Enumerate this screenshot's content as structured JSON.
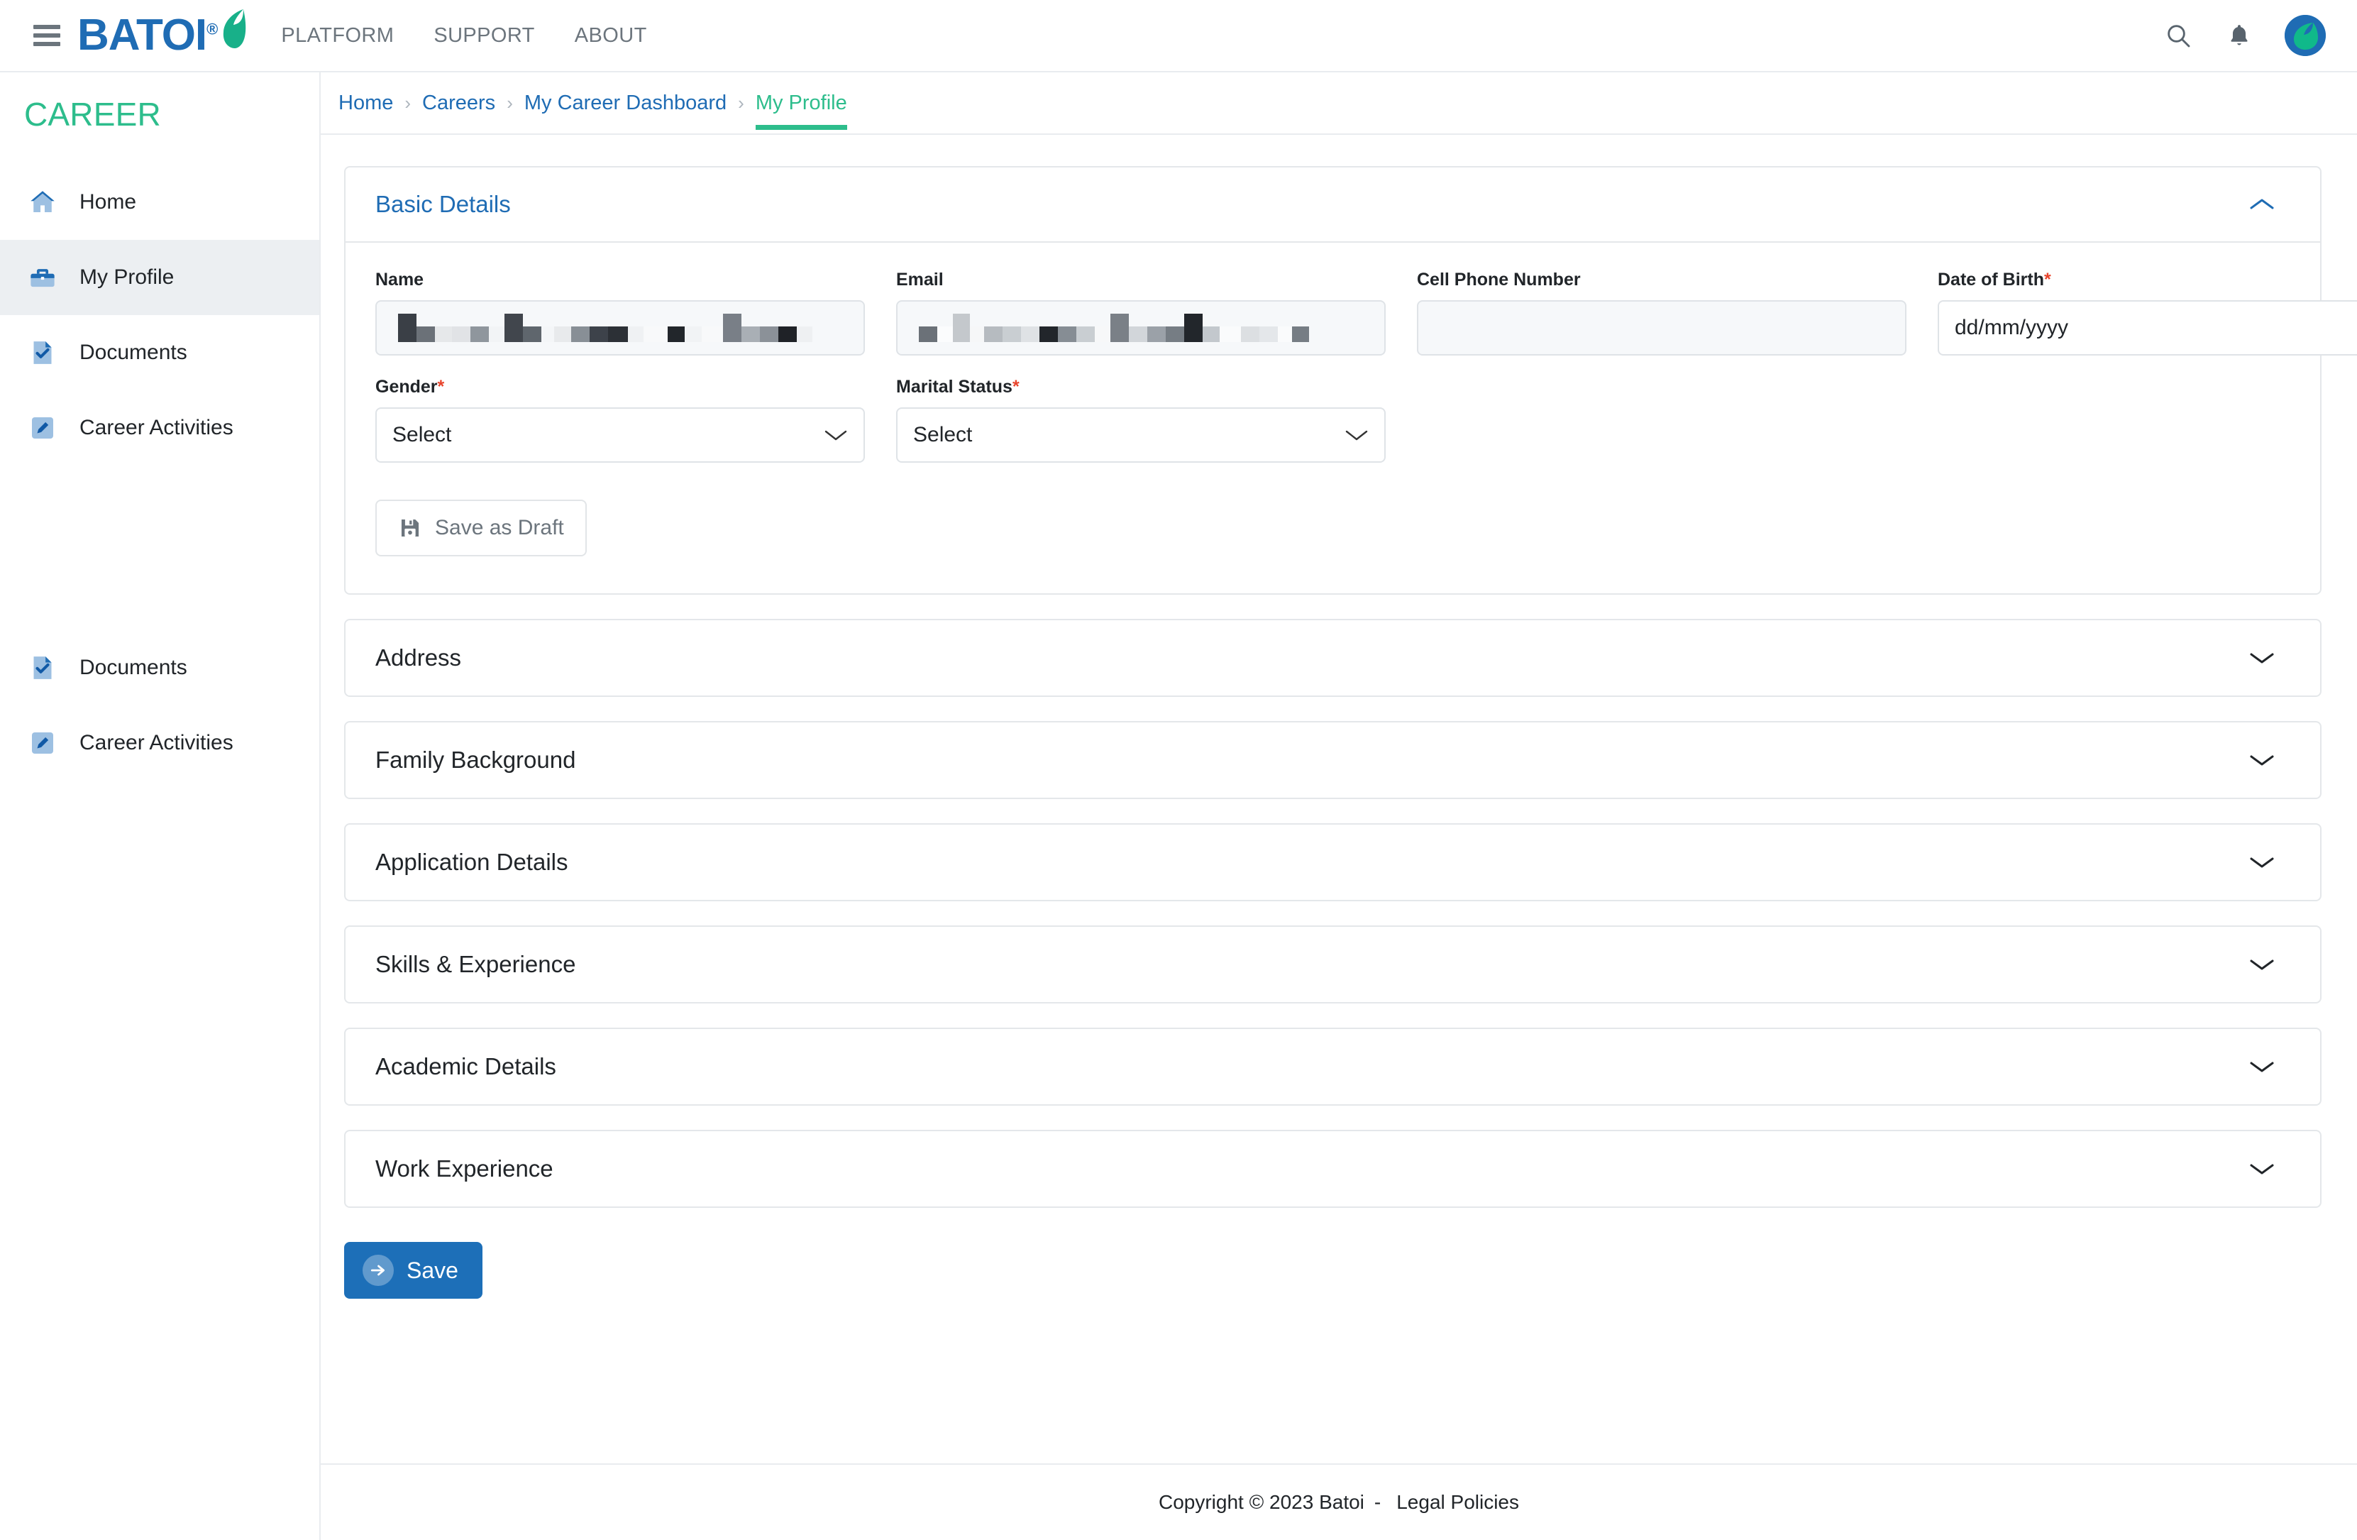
{
  "header": {
    "menu_icon": "hamburger-icon",
    "logo_text": "BATOI",
    "logo_reg": "®",
    "nav": [
      {
        "label": "PLATFORM"
      },
      {
        "label": "SUPPORT"
      },
      {
        "label": "ABOUT"
      }
    ],
    "search_icon": "search-icon",
    "notification_icon": "bell-icon",
    "avatar": "user-avatar"
  },
  "sidebar": {
    "title": "CAREER",
    "items": [
      {
        "label": "Home",
        "icon": "home-icon",
        "active": false
      },
      {
        "label": "My Profile",
        "icon": "briefcase-icon",
        "active": true
      },
      {
        "label": "Documents",
        "icon": "document-check-icon",
        "active": false
      },
      {
        "label": "Career Activities",
        "icon": "pencil-icon",
        "active": false
      }
    ],
    "secondary_items": [
      {
        "label": "Documents",
        "icon": "document-check-icon"
      },
      {
        "label": "Career Activities",
        "icon": "pencil-icon"
      }
    ]
  },
  "breadcrumb": {
    "items": [
      {
        "label": "Home",
        "current": false
      },
      {
        "label": "Careers",
        "current": false
      },
      {
        "label": "My Career Dashboard",
        "current": false
      },
      {
        "label": "My Profile",
        "current": true
      }
    ],
    "separator": "›"
  },
  "basic_details": {
    "title": "Basic Details",
    "expanded": true,
    "fields": {
      "name": {
        "label": "Name",
        "value": "",
        "redacted": true,
        "disabled": true
      },
      "email": {
        "label": "Email",
        "value": "",
        "redacted": true,
        "disabled": true
      },
      "cell_phone": {
        "label": "Cell Phone Number",
        "value": "",
        "disabled": true
      },
      "date_of_birth": {
        "label": "Date of Birth",
        "required": true,
        "placeholder": "dd/mm/yyyy",
        "value": ""
      },
      "gender": {
        "label": "Gender",
        "required": true,
        "value": "Select",
        "options": [
          "Select"
        ]
      },
      "marital_status": {
        "label": "Marital Status",
        "required": true,
        "value": "Select",
        "options": [
          "Select"
        ]
      }
    },
    "draft_button": {
      "label": "Save as Draft",
      "icon": "save-icon"
    }
  },
  "sections": [
    {
      "title": "Address",
      "expanded": false
    },
    {
      "title": "Family Background",
      "expanded": false
    },
    {
      "title": "Application Details",
      "expanded": false
    },
    {
      "title": "Skills & Experience",
      "expanded": false
    },
    {
      "title": "Academic Details",
      "expanded": false
    },
    {
      "title": "Work Experience",
      "expanded": false
    }
  ],
  "save_button": {
    "label": "Save",
    "icon": "arrow-right-icon"
  },
  "footer": {
    "copyright": "Copyright © 2023 Batoi",
    "dash": "-",
    "legal_link": "Legal Policies"
  },
  "colors": {
    "brand_blue": "#1f6cb4",
    "brand_green": "#2dbd8c",
    "required_red": "#e8442c",
    "primary_button": "#1d6fb8",
    "sidebar_active": "#eceff2",
    "border": "#e4e7ea"
  }
}
